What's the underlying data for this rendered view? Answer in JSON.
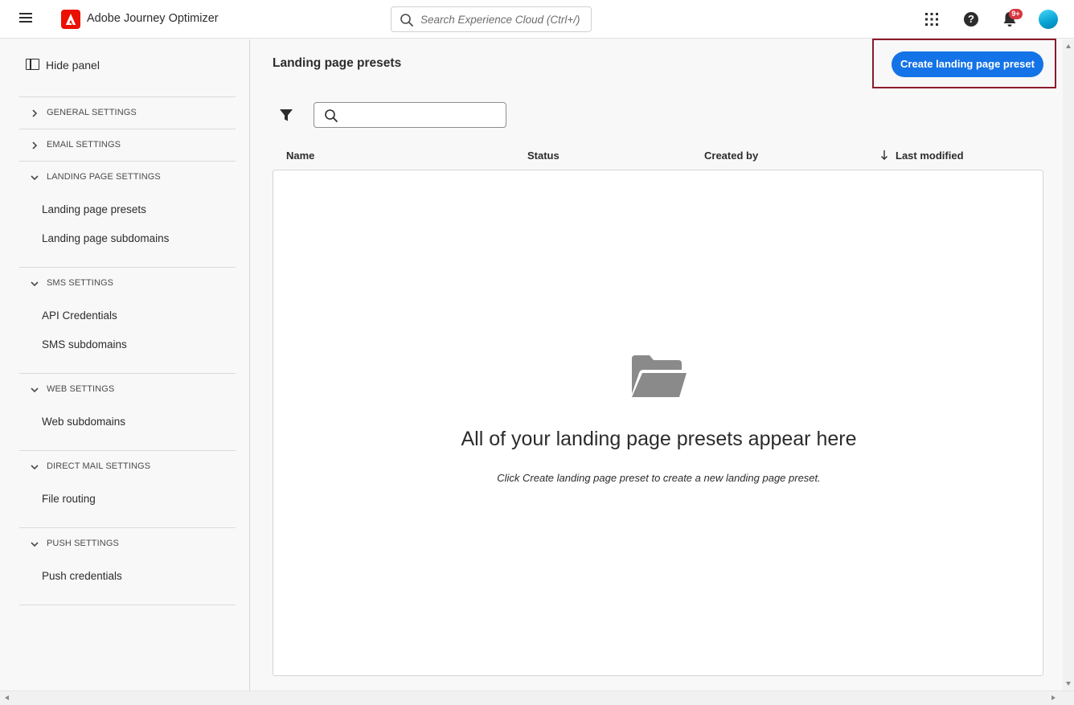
{
  "header": {
    "app_title": "Adobe Journey Optimizer",
    "search_placeholder": "Search Experience Cloud (Ctrl+/)",
    "notification_badge": "9+",
    "icons": [
      "hamburger-icon",
      "adobe-logo-icon",
      "search-icon",
      "apps-grid-icon",
      "help-icon",
      "bell-icon",
      "avatar"
    ]
  },
  "sidebar": {
    "hide_panel_label": "Hide panel",
    "sections": [
      {
        "label": "GENERAL SETTINGS",
        "expanded": false,
        "items": []
      },
      {
        "label": "EMAIL SETTINGS",
        "expanded": false,
        "items": []
      },
      {
        "label": "LANDING PAGE SETTINGS",
        "expanded": true,
        "items": [
          "Landing page presets",
          "Landing page subdomains"
        ]
      },
      {
        "label": "SMS SETTINGS",
        "expanded": true,
        "items": [
          "API Credentials",
          "SMS subdomains"
        ]
      },
      {
        "label": "WEB SETTINGS",
        "expanded": true,
        "items": [
          "Web subdomains"
        ]
      },
      {
        "label": "DIRECT MAIL SETTINGS",
        "expanded": true,
        "items": [
          "File routing"
        ]
      },
      {
        "label": "PUSH SETTINGS",
        "expanded": true,
        "items": [
          "Push credentials"
        ]
      }
    ]
  },
  "main": {
    "page_title": "Landing page presets",
    "create_button_label": "Create landing page preset",
    "table": {
      "columns": [
        "Name",
        "Status",
        "Created by",
        "Last modified"
      ],
      "sorted_column": "Last modified",
      "sort_direction": "descending",
      "rows": []
    },
    "empty_state": {
      "title": "All of your landing page presets appear here",
      "description": "Click Create landing page preset to create a new landing page preset."
    }
  },
  "colors": {
    "accent": "#1473e6",
    "brand_red": "#eb1000",
    "highlight_outline": "#8b1a2b",
    "badge": "#d7373f"
  }
}
